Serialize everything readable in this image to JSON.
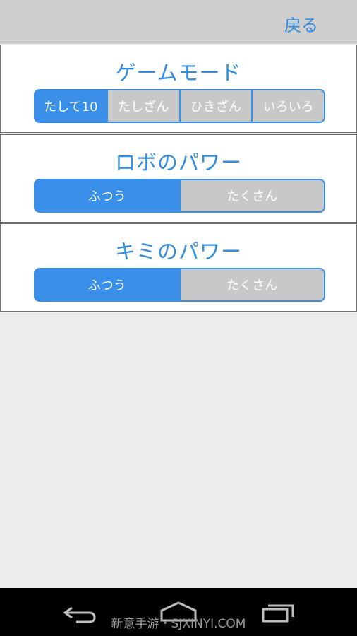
{
  "header": {
    "back_label": "戻る"
  },
  "game_mode": {
    "title": "ゲームモード",
    "options": [
      "たして10",
      "たしざん",
      "ひきざん",
      "いろいろ"
    ],
    "selected": "たして10"
  },
  "robo_power": {
    "title": "ロボのパワー",
    "options": [
      "ふつう",
      "たくさん"
    ],
    "selected": "ふつう"
  },
  "kimi_power": {
    "title": "キミのパワー",
    "options": [
      "ふつう",
      "たくさん"
    ],
    "selected": "ふつう"
  },
  "system_nav": {
    "icons": [
      "back-icon",
      "home-icon",
      "recents-icon"
    ],
    "watermark": "新意手游・SJXINYI.COM"
  },
  "colors": {
    "accent": "#3a8fe8",
    "inactive": "#c8c8c8",
    "topbar": "#cfcfcf",
    "background": "#ececec"
  }
}
